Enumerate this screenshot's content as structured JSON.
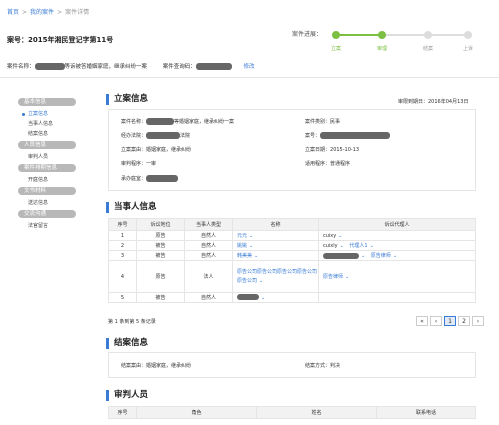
{
  "breadcrumb": {
    "home": "首页",
    "my_cases": "我的案件",
    "current": "案件详情",
    "sep": ">"
  },
  "case_no": "案号：2015年湘民登记字第11号",
  "progress": {
    "label": "案件进展：",
    "steps": [
      "立案",
      "审理",
      "结案",
      "上诉"
    ],
    "active_count": 2
  },
  "case_name_label": "案件名称：",
  "case_name_value": "等诉被答婚姻家庭，继承纠纷一案",
  "case_query_code_label": "案件查询码：",
  "modify_link": "修改",
  "sidebar": [
    {
      "section": "基本信息",
      "items": [
        {
          "label": "立案信息",
          "active": true
        },
        {
          "label": "当事人信息"
        },
        {
          "label": "结案信息"
        }
      ]
    },
    {
      "section": "人员信息",
      "items": [
        {
          "label": "审判人员"
        }
      ]
    },
    {
      "section": "案件排期信息",
      "items": [
        {
          "label": "开庭信息"
        }
      ]
    },
    {
      "section": "文书材料",
      "items": [
        {
          "label": "送达信息"
        }
      ]
    },
    {
      "section": "交流沟通",
      "items": [
        {
          "label": "法官留言"
        }
      ]
    }
  ],
  "filing": {
    "title": "立案信息",
    "review_date": "审限到期日：2016年04月13日",
    "case_name_label": "案件名称：",
    "case_name_value": "等婚姻家庭，继承纠纷一案",
    "court_label": "经办法院：",
    "court_value": "法院",
    "cause_label": "立案案由：",
    "cause_value": "婚姻家庭，继承纠纷",
    "procedure_label": "审判程序：",
    "procedure_value": "一审",
    "court_room_label": "承办庭室：",
    "category_label": "案件类别：",
    "category_value": "民事",
    "caseno_label": "案号：",
    "date_label": "立案日期：",
    "date_value": "2015-10-13",
    "applicable_label": "适用程序：",
    "applicable_value": "普通程序"
  },
  "parties": {
    "title": "当事人信息",
    "headers": [
      "序号",
      "诉讼地位",
      "当事人类型",
      "名称",
      "诉讼代理人"
    ],
    "rows": [
      {
        "no": "1",
        "role": "原告",
        "type": "自然人",
        "name": "元元",
        "agent": "cuixy",
        "agent2": ""
      },
      {
        "no": "2",
        "role": "被告",
        "type": "自然人",
        "name": "姚姚",
        "agent": "cuixly",
        "agent2": "代理人1"
      },
      {
        "no": "3",
        "role": "被告",
        "type": "自然人",
        "name": "韩美美",
        "agent": "",
        "agent2": "原告律师"
      },
      {
        "no": "4",
        "role": "原告",
        "type": "法人",
        "name": "原告公司原告公司原告公司原告公司原告公司",
        "agent": "原告律师",
        "agent2": ""
      },
      {
        "no": "5",
        "role": "被告",
        "type": "自然人",
        "name": "",
        "agent": "",
        "agent2": ""
      }
    ],
    "footer": "第 1 条到第 5 条记录",
    "pages": [
      "«",
      "‹",
      "1",
      "2",
      "›"
    ]
  },
  "closing": {
    "title": "结案信息",
    "cause_label": "结案案由：",
    "cause_value": "婚姻家庭，继承纠纷",
    "method_label": "结案方式：",
    "method_value": "判决"
  },
  "judges": {
    "title": "审判人员",
    "headers": [
      "序号",
      "角色",
      "姓名",
      "联系电话"
    ]
  }
}
